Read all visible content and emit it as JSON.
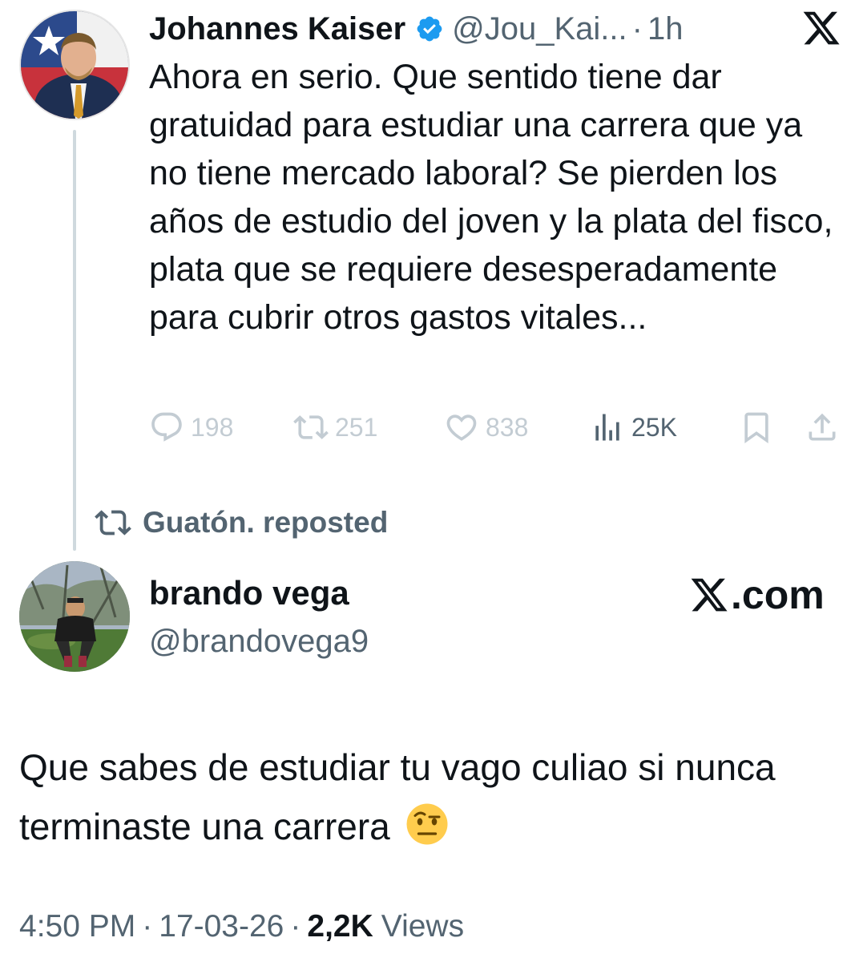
{
  "parent_tweet": {
    "author_name": "Johannes Kaiser",
    "handle": "@Jou_Kai...",
    "separator": "·",
    "time_ago": "1h",
    "text": "Ahora en serio. Que sentido tiene dar gratuidad para estudiar una carrera que ya no tiene mercado laboral? Se pierden los años de estudio del joven y la plata del fisco, plata que se requiere desesperadamente para cubrir otros gastos vitales...",
    "actions": {
      "replies": "198",
      "retweets": "251",
      "likes": "838",
      "views": "25K"
    },
    "icons": [
      "verified-badge-icon",
      "x-logo-icon",
      "reply-icon",
      "retweet-icon",
      "like-icon",
      "views-icon",
      "bookmark-icon",
      "share-icon"
    ]
  },
  "repost_banner": {
    "text": "Guatón. reposted",
    "icon": "retweet-icon"
  },
  "reply_tweet": {
    "author_name": "brando vega",
    "handle": "@brandovega9",
    "brand_text": ".com",
    "text": "Que sabes de estudiar tu vago culiao si nunca terminaste una carrera",
    "emoji": "face-with-raised-eyebrow-emoji"
  },
  "meta": {
    "time": "4:50 PM",
    "separator": "·",
    "date": "17-03-26",
    "views_count": "2,2K",
    "views_label": "Views"
  },
  "colors": {
    "text_primary": "#0f1419",
    "text_secondary": "#536471",
    "action_faded": "#c3ccd3",
    "verified_blue": "#1d9bf0",
    "thread_line": "#cfd9de"
  }
}
